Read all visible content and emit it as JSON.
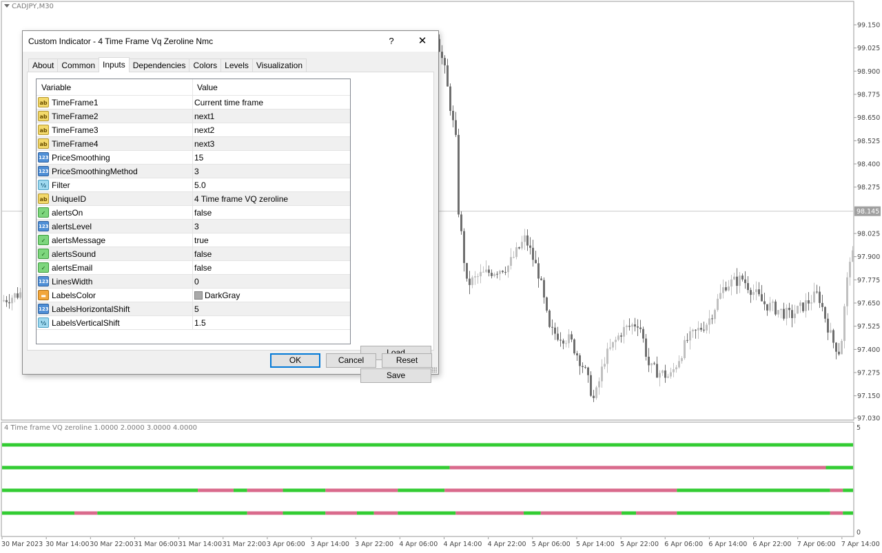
{
  "chart": {
    "symbol_label": "CADJPY,M30",
    "price_ticks": [
      "99.150",
      "99.025",
      "98.900",
      "98.775",
      "98.650",
      "98.525",
      "98.400",
      "98.275",
      "98.145",
      "98.025",
      "97.900",
      "97.775",
      "97.650",
      "97.525",
      "97.400",
      "97.275",
      "97.150",
      "97.030"
    ],
    "current_price": "98.145",
    "time_ticks": [
      "30 Mar 2023",
      "30 Mar 14:00",
      "30 Mar 22:00",
      "31 Mar 06:00",
      "31 Mar 14:00",
      "31 Mar 22:00",
      "3 Apr 06:00",
      "3 Apr 14:00",
      "3 Apr 22:00",
      "4 Apr 06:00",
      "4 Apr 14:00",
      "4 Apr 22:00",
      "5 Apr 06:00",
      "5 Apr 14:00",
      "5 Apr 22:00",
      "6 Apr 06:00",
      "6 Apr 14:00",
      "6 Apr 22:00",
      "7 Apr 06:00",
      "7 Apr 14:00"
    ],
    "colors": {
      "bull": "#c0c0c0",
      "bear": "#6e6e6e",
      "current_line": "#c8c8c8",
      "price_tag": "#a0a0a0"
    }
  },
  "indicator": {
    "title": "4 Time frame VQ zeroline 1.0000 2.0000 3.0000 4.0000",
    "scale_top": "5",
    "scale_bottom": "0",
    "colors": {
      "up": "#33cc33",
      "down": "#d96a8c"
    },
    "lines": [
      {
        "segments": [
          [
            "up",
            0,
            1
          ]
        ]
      },
      {
        "segments": [
          [
            "up",
            0,
            0.526
          ],
          [
            "down",
            0.526,
            0.968
          ],
          [
            "up",
            0.968,
            1
          ]
        ]
      },
      {
        "segments": [
          [
            "up",
            0,
            0.23
          ],
          [
            "down",
            0.23,
            0.272
          ],
          [
            "up",
            0.272,
            0.288
          ],
          [
            "down",
            0.288,
            0.33
          ],
          [
            "up",
            0.33,
            0.38
          ],
          [
            "down",
            0.38,
            0.465
          ],
          [
            "up",
            0.465,
            0.52
          ],
          [
            "down",
            0.52,
            0.793
          ],
          [
            "up",
            0.793,
            0.973
          ],
          [
            "down",
            0.973,
            0.988
          ],
          [
            "up",
            0.988,
            1
          ]
        ]
      },
      {
        "segments": [
          [
            "up",
            0,
            0.085
          ],
          [
            "down",
            0.085,
            0.112
          ],
          [
            "up",
            0.112,
            0.288
          ],
          [
            "down",
            0.288,
            0.33
          ],
          [
            "up",
            0.33,
            0.38
          ],
          [
            "down",
            0.38,
            0.417
          ],
          [
            "up",
            0.417,
            0.437
          ],
          [
            "down",
            0.437,
            0.465
          ],
          [
            "up",
            0.465,
            0.533
          ],
          [
            "down",
            0.533,
            0.613
          ],
          [
            "up",
            0.613,
            0.633
          ],
          [
            "down",
            0.633,
            0.728
          ],
          [
            "up",
            0.728,
            0.745
          ],
          [
            "down",
            0.745,
            0.793
          ],
          [
            "up",
            0.793,
            0.973
          ],
          [
            "down",
            0.973,
            0.988
          ],
          [
            "up",
            0.988,
            1
          ]
        ]
      }
    ]
  },
  "dialog": {
    "title": "Custom Indicator - 4 Time Frame Vq Zeroline Nmc",
    "help_label": "?",
    "close_label": "✕",
    "tabs": [
      "About",
      "Common",
      "Inputs",
      "Dependencies",
      "Colors",
      "Levels",
      "Visualization"
    ],
    "active_tab": "Inputs",
    "table": {
      "col_variable": "Variable",
      "col_value": "Value",
      "rows": [
        {
          "icon": "string-type-icon",
          "type": "ab",
          "name": "TimeFrame1",
          "value": "Current time frame"
        },
        {
          "icon": "string-type-icon",
          "type": "ab",
          "name": "TimeFrame2",
          "value": "next1"
        },
        {
          "icon": "string-type-icon",
          "type": "ab",
          "name": "TimeFrame3",
          "value": "next2"
        },
        {
          "icon": "string-type-icon",
          "type": "ab",
          "name": "TimeFrame4",
          "value": "next3"
        },
        {
          "icon": "integer-type-icon",
          "type": "123",
          "name": "PriceSmoothing",
          "value": "15"
        },
        {
          "icon": "integer-type-icon",
          "type": "123",
          "name": "PriceSmoothingMethod",
          "value": "3"
        },
        {
          "icon": "double-type-icon",
          "type": "½",
          "name": "Filter",
          "value": "5.0"
        },
        {
          "icon": "string-type-icon",
          "type": "ab",
          "name": "UniqueID",
          "value": "4 Time frame VQ zeroline"
        },
        {
          "icon": "bool-type-icon",
          "type": "✓",
          "name": "alertsOn",
          "value": "false"
        },
        {
          "icon": "integer-type-icon",
          "type": "123",
          "name": "alertsLevel",
          "value": "3"
        },
        {
          "icon": "bool-type-icon",
          "type": "✓",
          "name": "alertsMessage",
          "value": "true"
        },
        {
          "icon": "bool-type-icon",
          "type": "✓",
          "name": "alertsSound",
          "value": "false"
        },
        {
          "icon": "bool-type-icon",
          "type": "✓",
          "name": "alertsEmail",
          "value": "false"
        },
        {
          "icon": "integer-type-icon",
          "type": "123",
          "name": "LinesWidth",
          "value": "0"
        },
        {
          "icon": "color-type-icon",
          "type": "▬",
          "name": "LabelsColor",
          "value": "DarkGray",
          "swatch": "#a9a9a9"
        },
        {
          "icon": "integer-type-icon",
          "type": "123",
          "name": "LabelsHorizontalShift",
          "value": "5"
        },
        {
          "icon": "double-type-icon",
          "type": "½",
          "name": "LabelsVerticalShift",
          "value": "1.5"
        }
      ]
    },
    "buttons": {
      "load": "Load",
      "save": "Save",
      "ok": "OK",
      "cancel": "Cancel",
      "reset": "Reset"
    }
  }
}
